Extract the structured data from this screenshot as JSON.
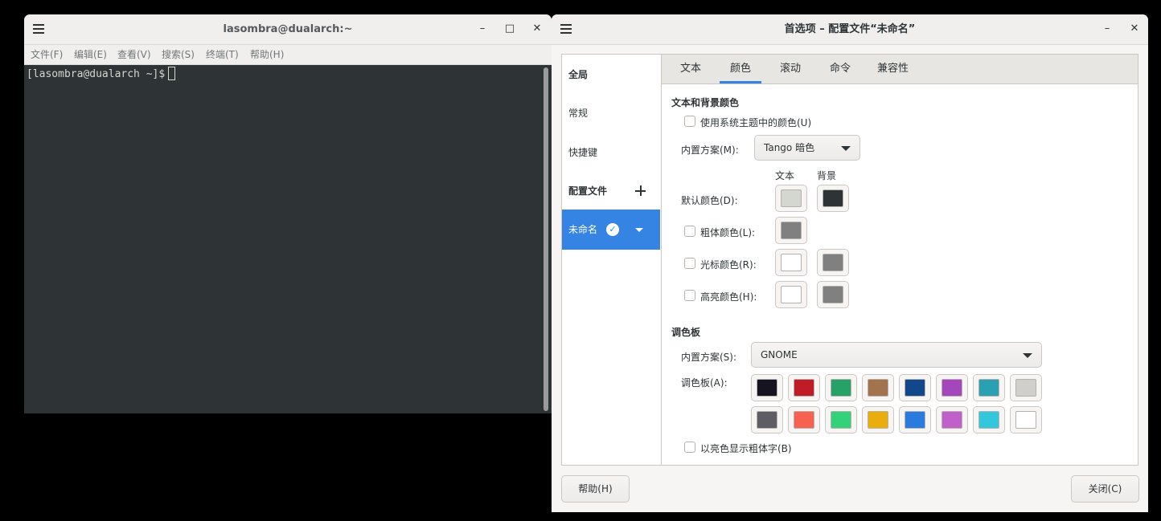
{
  "terminal": {
    "title": "lasombra@dualarch:~",
    "controls": {
      "minimize": "–",
      "maximize": "□",
      "close": "✕"
    },
    "menu": [
      "文件(F)",
      "编辑(E)",
      "查看(V)",
      "搜索(S)",
      "终端(T)",
      "帮助(H)"
    ],
    "prompt": "[lasombra@dualarch ~]$"
  },
  "prefs": {
    "title": "首选项 – 配置文件“未命名”",
    "controls": {
      "minimize": "–",
      "close": "✕"
    },
    "sidebar": {
      "global": "全局",
      "general": "常规",
      "shortcuts": "快捷键",
      "profiles": "配置文件",
      "profile_name": "未命名"
    },
    "tabs": [
      "文本",
      "颜色",
      "滚动",
      "命令",
      "兼容性"
    ],
    "active_tab": "颜色",
    "text_bg": {
      "section": "文本和背景颜色",
      "use_system": "使用系统主题中的颜色(U)",
      "builtin_label": "内置方案(M):",
      "builtin_value": "Tango 暗色",
      "col_text": "文本",
      "col_bg": "背景",
      "default_color": "默认颜色(D):",
      "bold_color": "粗体颜色(L):",
      "cursor_color": "光标颜色(R):",
      "highlight_color": "高亮颜色(H):"
    },
    "colors": {
      "default_text": "#d3d7cf",
      "default_bg": "#2e3436",
      "bold": "#808080",
      "cursor_text": "#ffffff",
      "cursor_bg": "#808080",
      "highlight_text": "#ffffff",
      "highlight_bg": "#808080"
    },
    "palette": {
      "section": "调色板",
      "builtin_label": "内置方案(S):",
      "builtin_value": "GNOME",
      "palette_label": "调色板(A):",
      "row1": [
        "#171421",
        "#c01c28",
        "#26a269",
        "#a2734c",
        "#12488b",
        "#a347ba",
        "#2aa1b3",
        "#d0cfcc"
      ],
      "row2": [
        "#5e5c64",
        "#f66151",
        "#33d17a",
        "#e9ad0c",
        "#2a7bde",
        "#c061cb",
        "#33c7de",
        "#ffffff"
      ],
      "bold_bright": "以亮色显示粗体字(B)"
    },
    "buttons": {
      "help": "帮助(H)",
      "close": "关闭(C)"
    }
  }
}
